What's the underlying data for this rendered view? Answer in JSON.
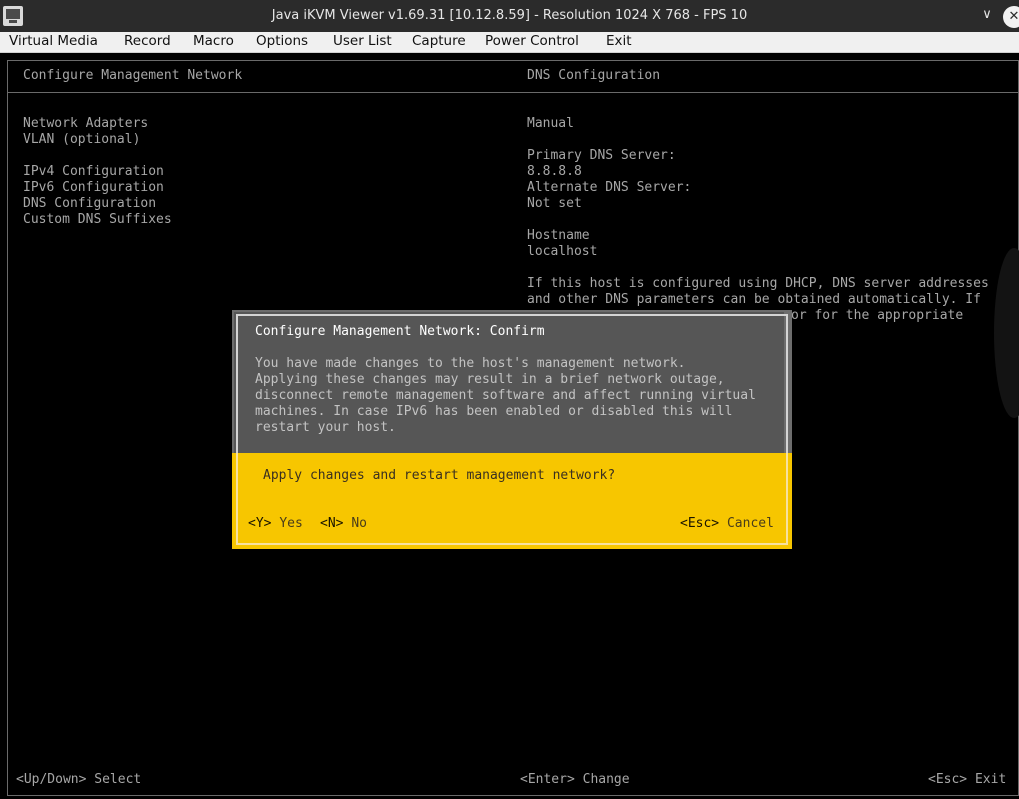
{
  "window": {
    "title": "Java iKVM Viewer v1.69.31 [10.12.8.59] - Resolution 1024 X 768 - FPS 10"
  },
  "menu": [
    "Virtual Media",
    "Record",
    "Macro",
    "Options",
    "User List",
    "Capture",
    "Power Control",
    "Exit"
  ],
  "left_panel": {
    "title": "Configure Management Network",
    "items": [
      "Network Adapters",
      "VLAN (optional)",
      "IPv4 Configuration",
      "IPv6 Configuration",
      "DNS Configuration",
      "Custom DNS Suffixes"
    ]
  },
  "right_panel": {
    "title": "DNS Configuration",
    "mode": "Manual",
    "primary_label": "Primary DNS Server:",
    "primary_value": "8.8.8.8",
    "alternate_label": "Alternate DNS Server:",
    "alternate_value": "Not set",
    "hostname_label": "Hostname",
    "hostname_value": "localhost",
    "help_line1": "If this host is configured using DHCP, DNS server addresses",
    "help_line2": "and other DNS parameters can be obtained automatically. If",
    "help_line3": "or for the appropriate"
  },
  "dialog": {
    "title": "Configure Management Network: Confirm",
    "body": [
      "You have made changes to the host's management network.",
      "Applying these changes may result in a brief network outage,",
      "disconnect remote management software and affect running virtual",
      "machines. In case IPv6 has been enabled or disabled this will",
      "restart your host."
    ],
    "question": "Apply changes and restart management network?",
    "yes_key": "<Y>",
    "yes_label": "Yes",
    "no_key": "<N>",
    "no_label": "No",
    "cancel_key": "<Esc>",
    "cancel_label": "Cancel"
  },
  "footer": {
    "left": "<Up/Down> Select",
    "center": "<Enter> Change",
    "right": "<Esc> Exit"
  },
  "colors": {
    "dialog_highlight": "#f7c600",
    "console_bg": "#000000",
    "console_text": "#a7a7a7"
  }
}
